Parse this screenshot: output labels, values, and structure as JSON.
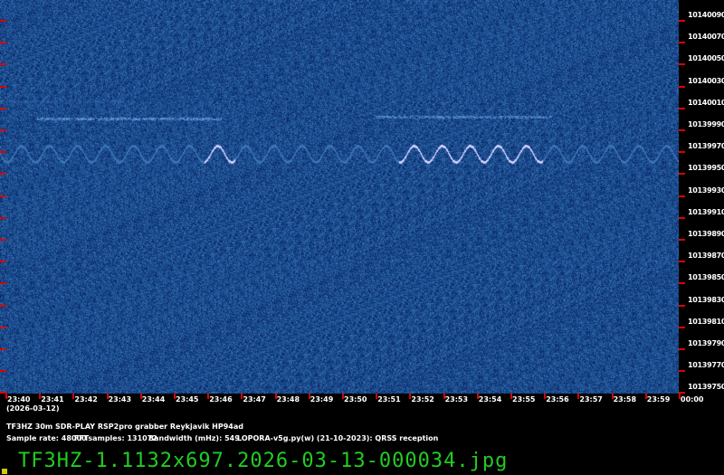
{
  "freq_labels": [
    "10140090",
    "10140070",
    "10140050",
    "10140030",
    "10140010",
    "10139990",
    "10139970",
    "10139950",
    "10139930",
    "10139910",
    "10139890",
    "10139870",
    "10139850",
    "10139830",
    "10139810",
    "10139790",
    "10139770",
    "10139750"
  ],
  "time_labels": [
    "23:40",
    "23:41",
    "23:42",
    "23:43",
    "23:44",
    "23:45",
    "23:46",
    "23:47",
    "23:48",
    "23:49",
    "23:50",
    "23:51",
    "23:52",
    "23:53",
    "23:54",
    "23:55",
    "23:56",
    "23:57",
    "23:58",
    "23:59",
    "00:00"
  ],
  "date_label": "(2026-03-12)",
  "station_line": "TF3HZ 30m SDR-PLAY RSP2pro grabber Reykjavik HP94ad",
  "sample_rate": "Sample rate: 48000",
  "fft_samples": "FFTsamples: 131072",
  "bandwidth": "Bandwidth (mHz): 549",
  "software": "LOPORA-v5g.py(w) (21-10-2023): QRSS reception",
  "filename": "TF3HZ-1.1132x697.2026-03-13-000034.jpg",
  "colors": {
    "background": "#0a1f6e",
    "signal": "#e8f4ff",
    "tick": "#dd0000",
    "filename": "#22cc22"
  }
}
